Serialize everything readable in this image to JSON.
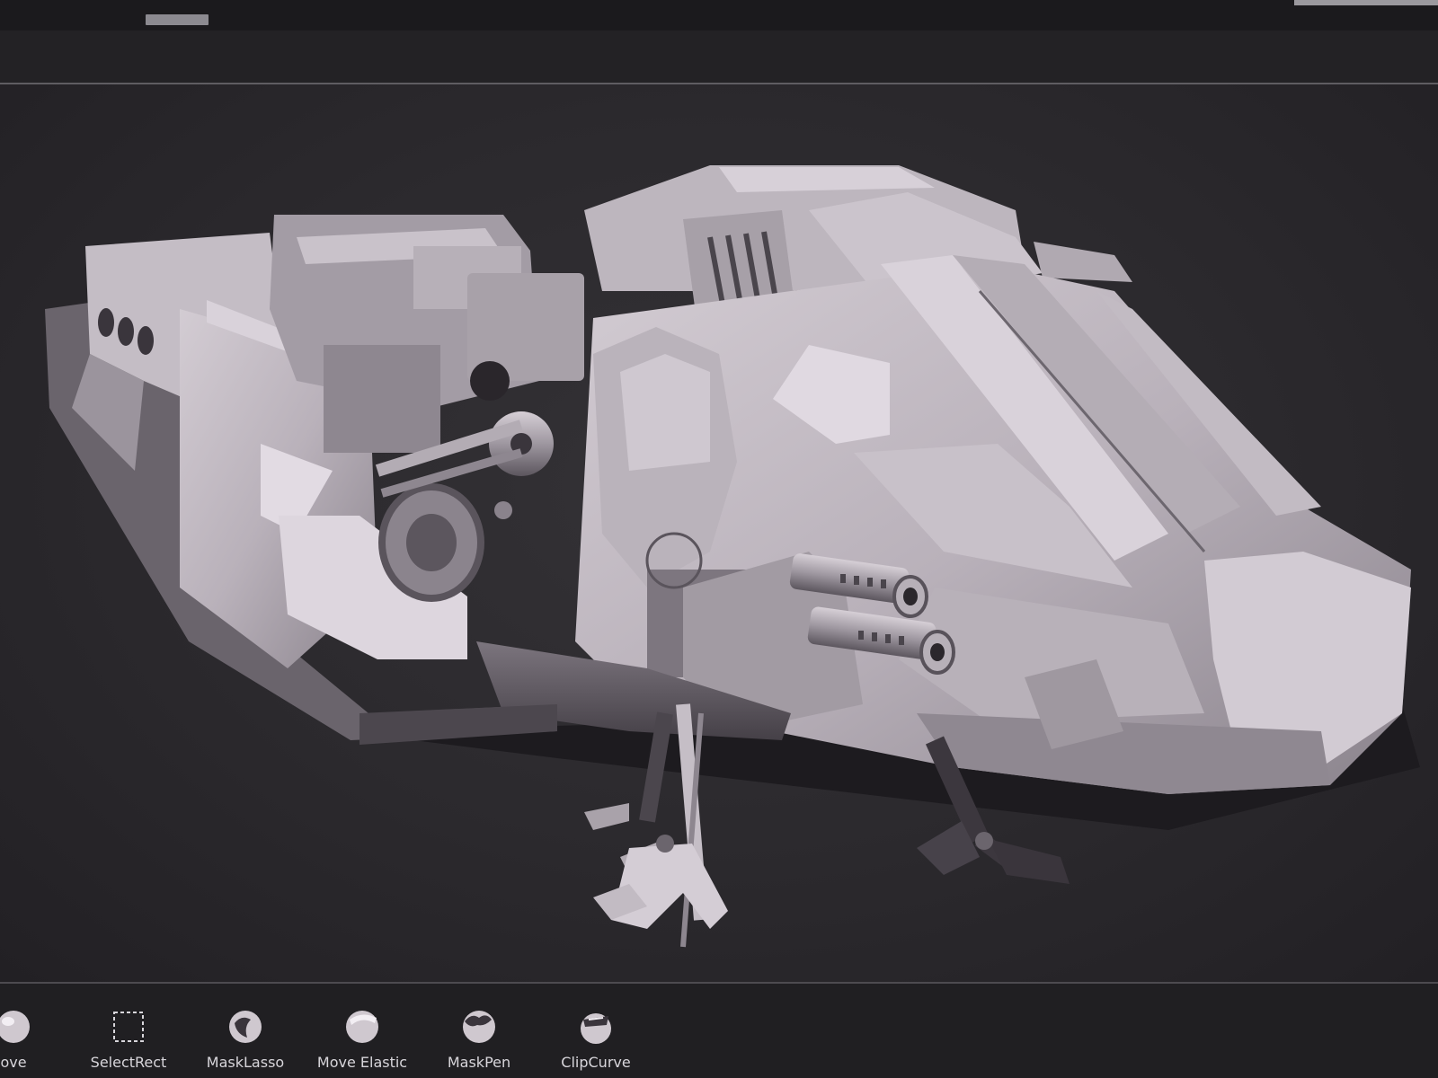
{
  "brushes": [
    {
      "name": "move",
      "label": "ove"
    },
    {
      "name": "selectrect",
      "label": "SelectRect"
    },
    {
      "name": "masklasso",
      "label": "MaskLasso"
    },
    {
      "name": "move-elastic",
      "label": "Move Elastic"
    },
    {
      "name": "maskpen",
      "label": "MaskPen"
    },
    {
      "name": "clipcurve",
      "label": "ClipCurve"
    }
  ],
  "colors": {
    "model_light": "#cfc8cf",
    "model_mid": "#a59ea7",
    "model_dark": "#5e5860",
    "canvas": "#2e2c30"
  },
  "icons": [
    "sphere-brush-icon",
    "select-rect-icon",
    "mask-lasso-icon",
    "move-elastic-icon",
    "mask-pen-icon",
    "clip-curve-icon"
  ]
}
